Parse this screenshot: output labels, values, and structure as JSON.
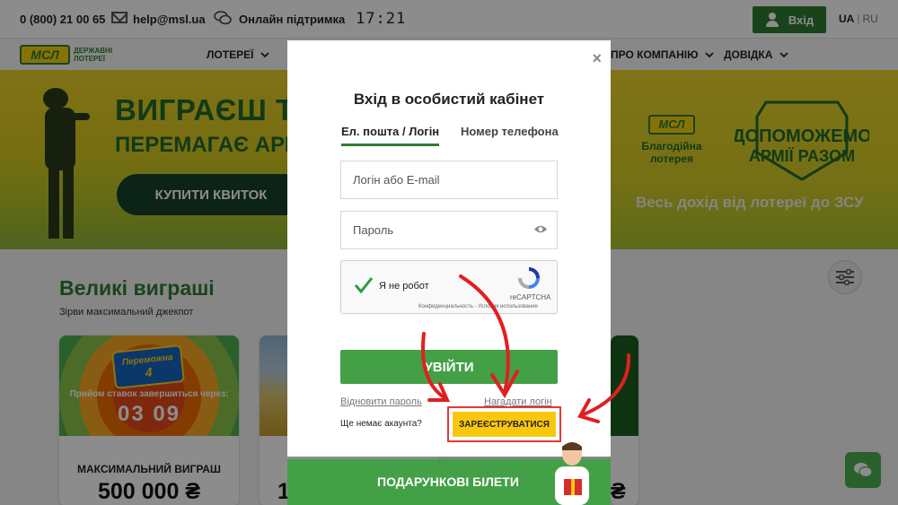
{
  "topbar": {
    "phone": "0 (800) 21 00 65",
    "email": "help@msl.ua",
    "support": "Онлайн підтримка",
    "time": "17:21",
    "login_label": "Вхід",
    "lang_ua": "UA",
    "lang_sep": "|",
    "lang_ru": "RU"
  },
  "logo": {
    "mark": "МСЛ",
    "text_line1": "ДЕРЖАВНІ",
    "text_line2": "ЛОТЕРЕЇ"
  },
  "nav": {
    "lotteries": "ЛОТЕРЕЇ",
    "about": "ПРО КОМПАНІЮ",
    "help": "ДОВІДКА"
  },
  "hero": {
    "title1": "ВИГРАЄШ ТИ",
    "title2": "ПЕРЕМАГАЄ АРМІЯ",
    "buy_label": "КУПИТИ КВИТОК",
    "charity_mark": "МСЛ",
    "charity_line1": "Благодійна",
    "charity_line2": "лотерея",
    "shield_line1": "ДОПОМОЖЕМО",
    "shield_line2": "АРМІЇ РАЗОМ",
    "proceeds": "Весь дохід від лотереї до ЗСУ"
  },
  "big_wins": {
    "title": "Великі виграші",
    "subtitle": "Зірви максимальний джекпот",
    "card1": {
      "badge_line1": "Переможна",
      "badge_line2": "4",
      "until": "Прийом ставок завершиться через:",
      "countdown": "03 09",
      "caption": "МАКСИМАЛЬНИЙ ВИГРАШ",
      "amount": "500 000 ₴"
    },
    "card2_fragment": "1",
    "card3_fragment": "₴"
  },
  "modal": {
    "close": "×",
    "title": "Вхід в особистий кабінет",
    "tab_email": "Ел. пошта / Логін",
    "tab_phone": "Номер телефона",
    "login_placeholder": "Логін або E-mail",
    "password_placeholder": "Пароль",
    "captcha_label": "Я не робот",
    "captcha_brand": "reCAPTCHA",
    "captcha_links": "Конфиденциальность - Условия использования",
    "submit_label": "УВІЙТИ",
    "restore_link": "Відновити пароль",
    "remind_link": "Нагадати логін",
    "no_account": "Ще немає акаунта?",
    "register_label": "ЗАРЕЄСТРУВАТИСЯ"
  },
  "gift": {
    "label": "ПОДАРУНКОВІ БІЛЕТИ"
  },
  "colors": {
    "brand_green": "#2e7d32",
    "button_green": "#43a047",
    "register_yellow": "#f9c80e",
    "highlight_red": "#e53935"
  },
  "icons": [
    "mail-icon",
    "chat-icon",
    "user-icon",
    "chevron-down-icon",
    "eye-icon",
    "checkmark-icon",
    "recaptcha-icon",
    "close-icon",
    "filter-icon",
    "chat-fab-icon",
    "annotation-arrow-icon"
  ]
}
